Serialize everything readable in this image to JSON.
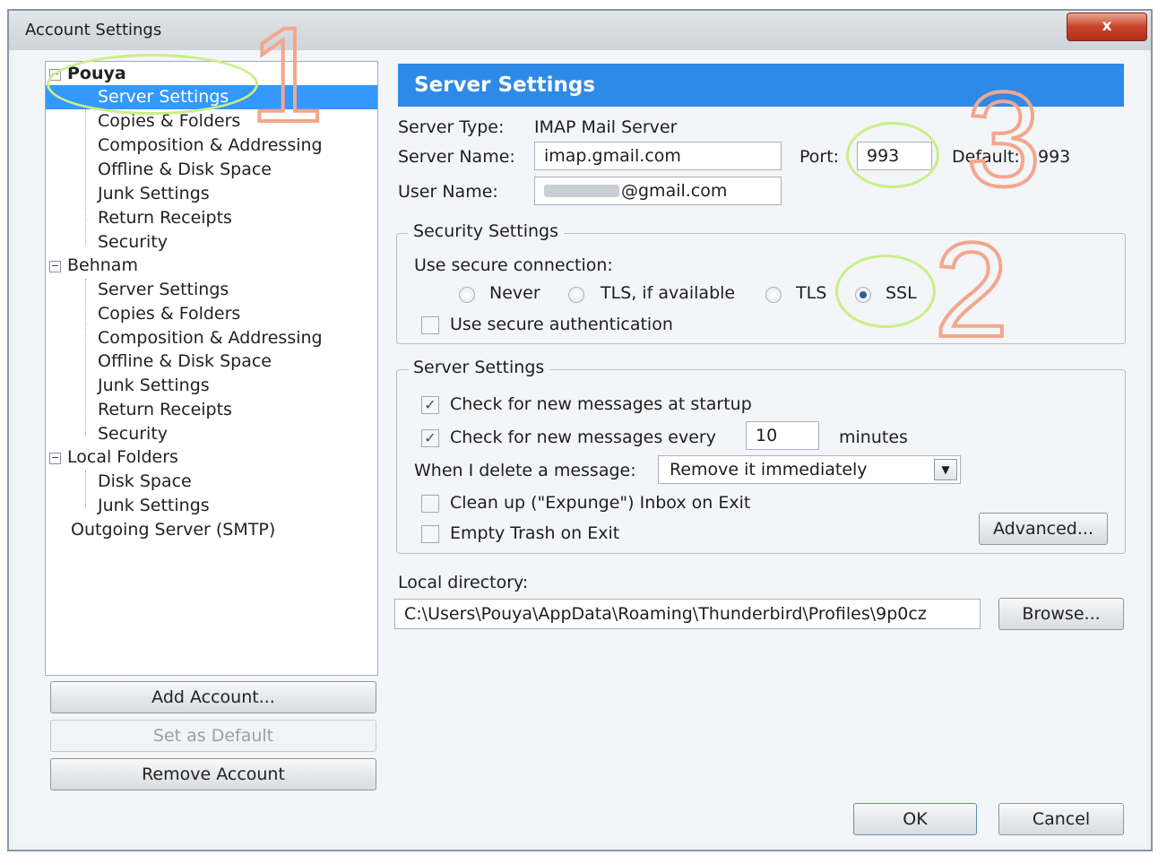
{
  "window": {
    "title": "Account Settings",
    "close_label": "x"
  },
  "tree": {
    "accounts": [
      {
        "name": "Pouya",
        "expander": "−",
        "items": [
          "Server Settings",
          "Copies & Folders",
          "Composition & Addressing",
          "Offline & Disk Space",
          "Junk Settings",
          "Return Receipts",
          "Security"
        ]
      },
      {
        "name": "Behnam",
        "expander": "−",
        "items": [
          "Server Settings",
          "Copies & Folders",
          "Composition & Addressing",
          "Offline & Disk Space",
          "Junk Settings",
          "Return Receipts",
          "Security"
        ]
      },
      {
        "name": "Local Folders",
        "expander": "−",
        "items": [
          "Disk Space",
          "Junk Settings"
        ]
      }
    ],
    "outgoing": "Outgoing Server (SMTP)",
    "selected": "Pouya / Server Settings"
  },
  "left_buttons": {
    "add": "Add Account...",
    "set_default": "Set as Default",
    "remove": "Remove Account"
  },
  "server": {
    "banner": "Server Settings",
    "type_label": "Server Type:",
    "type_value": "IMAP Mail Server",
    "name_label": "Server Name:",
    "name_value": "imap.gmail.com",
    "port_label": "Port:",
    "port_value": "993",
    "default_label": "Default:",
    "default_value": "993",
    "user_label": "User Name:",
    "user_value": "@gmail.com"
  },
  "security": {
    "legend": "Security Settings",
    "use_secure": "Use secure connection:",
    "options": [
      "Never",
      "TLS, if available",
      "TLS",
      "SSL"
    ],
    "selected_option": "SSL",
    "secure_auth": "Use secure authentication"
  },
  "server_settings": {
    "legend": "Server Settings",
    "check_startup": "Check for new messages at startup",
    "check_every": "Check for new messages every",
    "minutes_value": "10",
    "minutes_label": "minutes",
    "delete_label": "When I delete a message:",
    "delete_value": "Remove it immediately",
    "cleanup": "Clean up (\"Expunge\") Inbox on Exit",
    "empty_trash": "Empty Trash on Exit",
    "advanced": "Advanced..."
  },
  "local_dir": {
    "label": "Local directory:",
    "value": "C:\\Users\\Pouya\\AppData\\Roaming\\Thunderbird\\Profiles\\9p0cz",
    "browse": "Browse..."
  },
  "dialog": {
    "ok": "OK",
    "cancel": "Cancel"
  },
  "annotations": [
    "1",
    "2",
    "3"
  ],
  "colors": {
    "banner": "#2e8ae8",
    "selection": "#3399ff",
    "annotation": "#f2a78c",
    "highlight_circle": "#c9ef86"
  }
}
